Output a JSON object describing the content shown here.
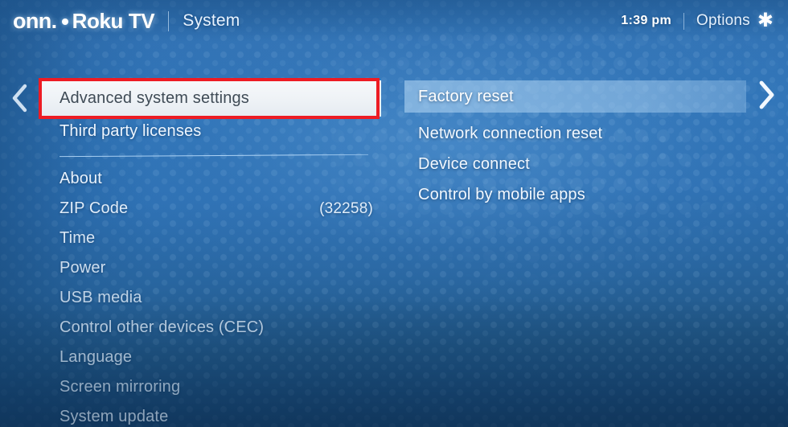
{
  "header": {
    "brand_onn": "onn.",
    "brand_bullet_icon": "dot-icon",
    "brand_roku": "Roku TV",
    "section": "System",
    "time": "1:39 pm",
    "options_label": "Options",
    "options_icon": "asterisk-star-icon"
  },
  "nav": {
    "left_chevron_icon": "chevron-left-icon",
    "right_chevron_icon": "chevron-right-icon"
  },
  "left_menu": {
    "items": [
      {
        "label": "Advanced system settings",
        "value": "",
        "focused": true
      },
      {
        "label": "Third party licenses",
        "value": "",
        "focused": false
      }
    ],
    "items_below": [
      {
        "label": "About",
        "value": ""
      },
      {
        "label": "ZIP Code",
        "value": "(32258)"
      },
      {
        "label": "Time",
        "value": ""
      },
      {
        "label": "Power",
        "value": ""
      },
      {
        "label": "USB media",
        "value": ""
      },
      {
        "label": "Control other devices (CEC)",
        "value": ""
      },
      {
        "label": "Language",
        "value": ""
      },
      {
        "label": "Screen mirroring",
        "value": ""
      },
      {
        "label": "System update",
        "value": ""
      }
    ]
  },
  "right_menu": {
    "items": [
      {
        "label": "Factory reset",
        "focused": true
      },
      {
        "label": "Network connection reset",
        "focused": false
      },
      {
        "label": "Device connect",
        "focused": false
      },
      {
        "label": "Control by mobile apps",
        "focused": false
      }
    ]
  },
  "annotation": {
    "type": "highlight-rectangle",
    "color": "#ed1c24",
    "target": "Advanced system settings"
  },
  "colors": {
    "background_blue": "#2f74b8",
    "background_blue_dark": "#18446d",
    "focus_bar": "#eef2f6",
    "focus_text": "#3f4b56",
    "menu_text": "#eef6ff",
    "annotation_red": "#ed1c24"
  }
}
